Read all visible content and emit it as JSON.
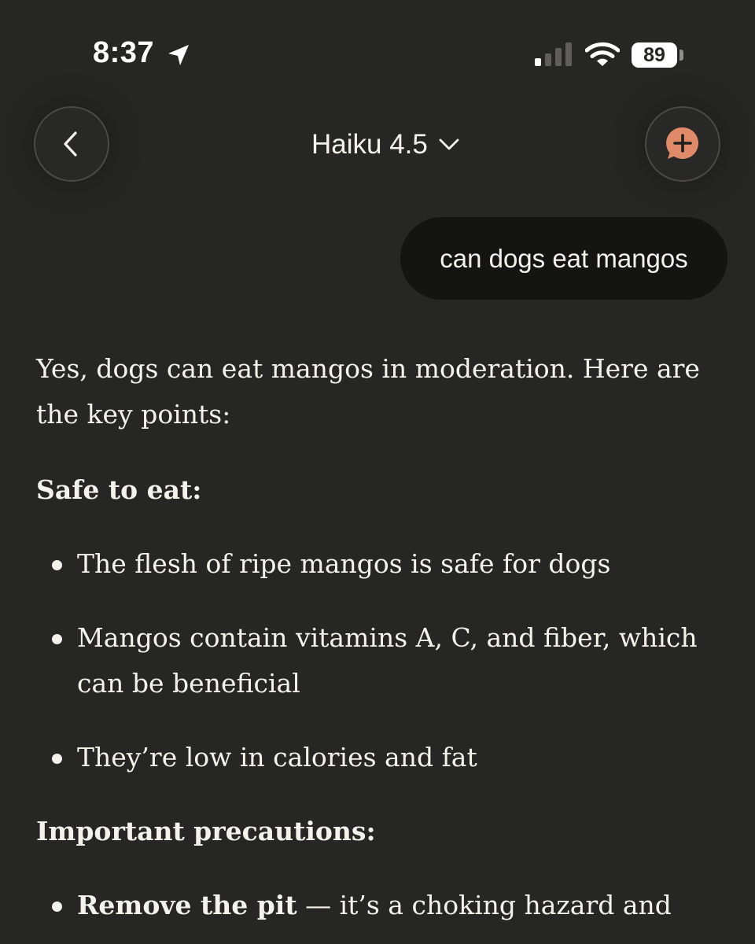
{
  "status_bar": {
    "time": "8:37",
    "battery_level": "89",
    "icons": [
      "location-arrow-icon",
      "cellular-signal-icon",
      "wifi-icon",
      "battery-icon"
    ]
  },
  "header": {
    "model_name": "Haiku 4.5",
    "back_icon": "chevron-left-icon",
    "model_dropdown_icon": "chevron-down-icon",
    "new_chat_icon": "chat-plus-icon",
    "accent_color": "#e08a69"
  },
  "conversation": {
    "user_message": "can dogs eat mangos",
    "response": {
      "intro": "Yes, dogs can eat mangos in moderation. Here are the key points:",
      "safe_heading": "Safe to eat:",
      "safe_items": [
        "The flesh of ripe mangos is safe for dogs",
        "Mangos contain vitamins A, C, and fiber, which can be beneficial",
        "They’re low in calories and fat"
      ],
      "precautions_heading": "Important precautions:",
      "precaution_items": [
        {
          "strong": "Remove the pit",
          "text": " — it’s a choking hazard and"
        }
      ]
    }
  }
}
